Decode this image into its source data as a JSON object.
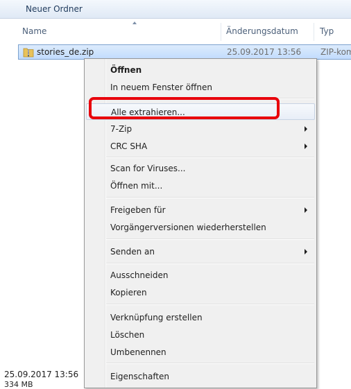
{
  "toolbar": {
    "folder_button": "Neuer Ordner"
  },
  "columns": {
    "name": "Name",
    "date": "Änderungsdatum",
    "type": "Typ"
  },
  "file": {
    "name": "stories_de.zip",
    "date": "25.09.2017 13:56",
    "type": "ZIP-kom"
  },
  "status": {
    "date": "25.09.2017 13:56",
    "size": "334 MB"
  },
  "context_menu": {
    "items": [
      {
        "label": "Öffnen",
        "bold": true
      },
      {
        "label": "In neuem Fenster öffnen"
      },
      {
        "label": "Alle extrahieren...",
        "highlighted": true
      },
      {
        "label": "7-Zip",
        "submenu": true
      },
      {
        "label": "CRC SHA",
        "submenu": true
      },
      {
        "label": "Scan for Viruses..."
      },
      {
        "label": "Öffnen mit..."
      },
      {
        "label": "Freigeben für",
        "submenu": true
      },
      {
        "label": "Vorgängerversionen wiederherstellen"
      },
      {
        "label": "Senden an",
        "submenu": true
      },
      {
        "label": "Ausschneiden"
      },
      {
        "label": "Kopieren"
      },
      {
        "label": "Verknüpfung erstellen"
      },
      {
        "label": "Löschen"
      },
      {
        "label": "Umbenennen"
      },
      {
        "label": "Eigenschaften"
      }
    ]
  },
  "colors": {
    "highlight_box": "#e8000b",
    "selection": "#c2dcfd"
  }
}
